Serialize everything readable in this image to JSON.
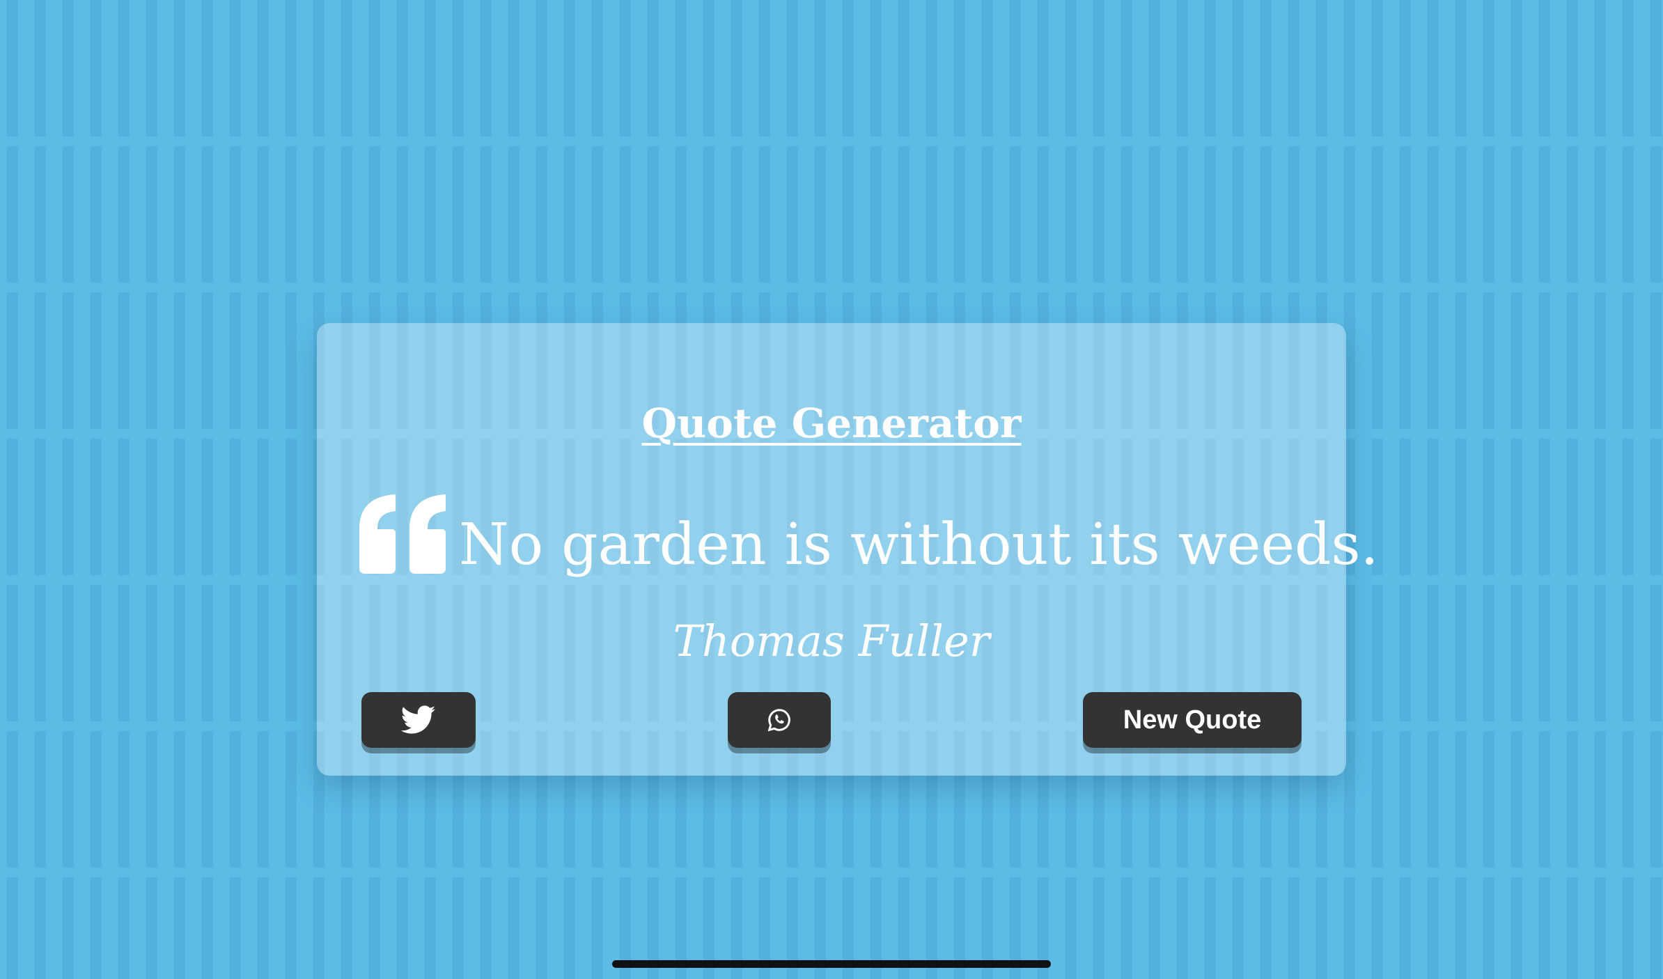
{
  "app": {
    "title": "Quote Generator"
  },
  "quote": {
    "text": "No garden is without its weeds.",
    "author": "Thomas Fuller",
    "icon": "quote-left-icon"
  },
  "actions": {
    "twitter_icon": "twitter-icon",
    "whatsapp_icon": "whatsapp-icon",
    "new_quote_label": "New Quote"
  },
  "colors": {
    "background": "#5dbbe6",
    "button": "#333333",
    "text": "#ffffff"
  }
}
